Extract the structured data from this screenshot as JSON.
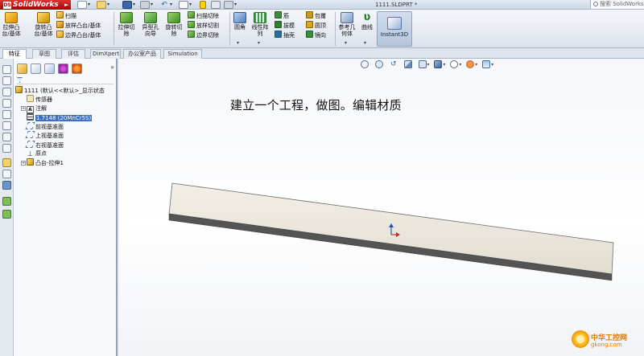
{
  "app": {
    "name": "SolidWorks",
    "doc_title": "1111.SLDPRT *",
    "search_placeholder": "搜索 SolidWorks"
  },
  "quick_access": [
    "new-doc-icon",
    "open-icon",
    "save-icon",
    "print-icon",
    "undo-icon",
    "select-icon",
    "rebuild-icon",
    "file-properties-icon",
    "options-icon"
  ],
  "ribbon": {
    "extrude_boss": "拉伸凸台/基体",
    "revolve_boss": "旋转凸台/基体",
    "sweep": "扫描",
    "loft_boss": "放样凸台/基体",
    "boundary_boss": "边界凸台/基体",
    "extrude_cut": "拉伸切除",
    "hole_wizard": "异型孔向导",
    "revolve_cut": "旋转切除",
    "swept_cut": "扫描切除",
    "lofted_cut": "放样切割",
    "boundary_cut": "边界切除",
    "fillet": "圆角",
    "linear_pattern": "线性阵列",
    "rib": "筋",
    "draft": "拔模",
    "shell": "抽壳",
    "wrap": "包覆",
    "dome": "圆顶",
    "mirror": "镜向",
    "reference_geometry": "参考几何体",
    "curves": "曲线",
    "instant3d": "Instant3D"
  },
  "tabs": [
    "特征",
    "草图",
    "评估",
    "DimXpert",
    "办公室产品",
    "Simulation"
  ],
  "active_tab": "特征",
  "feature_tree": {
    "part": "1111 (默认<<默认>_显示状态",
    "sensors": "传感器",
    "annotations": "注解",
    "material": "1.7148 (20MnCr5S)",
    "front_plane": "前视基准面",
    "top_plane": "上视基准面",
    "right_plane": "右视基准面",
    "origin": "原点",
    "boss_extrude": "凸台-拉伸1"
  },
  "graphics": {
    "annotation": "建立一个工程，做图。编辑材质"
  },
  "watermark": {
    "name": "中华工控网",
    "url": "gkong.com"
  }
}
